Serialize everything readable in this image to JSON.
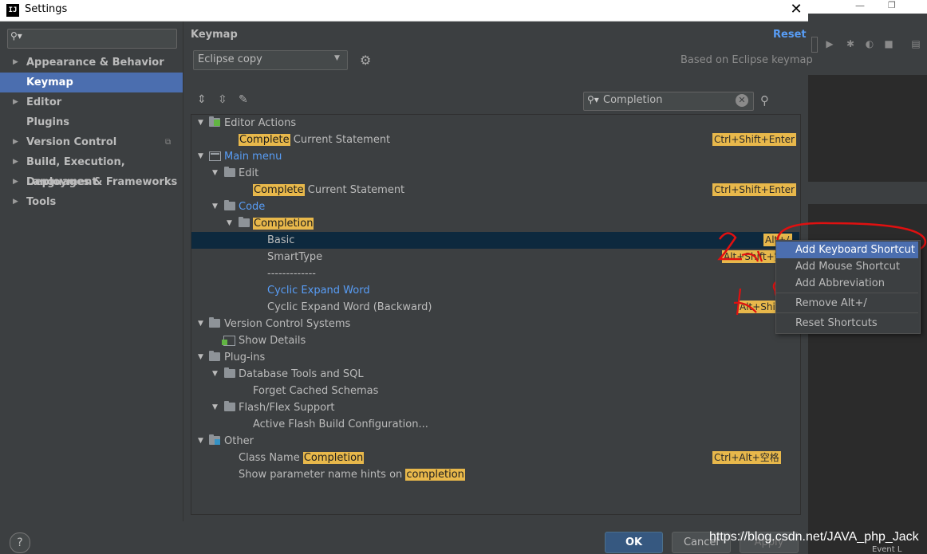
{
  "window": {
    "title": "Settings",
    "logo": "IJ",
    "close_icon": "✕"
  },
  "sidebar": {
    "search_placeholder": "",
    "items": [
      {
        "label": "Appearance & Behavior",
        "expandable": true
      },
      {
        "label": "Keymap",
        "selected": true
      },
      {
        "label": "Editor",
        "expandable": true
      },
      {
        "label": "Plugins"
      },
      {
        "label": "Version Control",
        "expandable": true
      },
      {
        "label": "Build, Execution, Deployment",
        "expandable": true
      },
      {
        "label": "Languages & Frameworks",
        "expandable": true
      },
      {
        "label": "Tools",
        "expandable": true
      }
    ]
  },
  "keymap": {
    "title": "Keymap",
    "reset": "Reset",
    "selected_keymap": "Eclipse copy",
    "based_on": "Based on Eclipse keymap",
    "filter_value": "Completion"
  },
  "tree": {
    "rows": [
      {
        "pre": "",
        "hl": "",
        "post": "Editor Actions",
        "shortcut": ""
      },
      {
        "pre": "",
        "hl": "Complete",
        "post": " Current Statement",
        "shortcut": "Ctrl+Shift+Enter"
      },
      {
        "pre": "",
        "hl": "",
        "post": "Main menu",
        "shortcut": ""
      },
      {
        "pre": "",
        "hl": "",
        "post": "Edit",
        "shortcut": ""
      },
      {
        "pre": "",
        "hl": "Complete",
        "post": " Current Statement",
        "shortcut": "Ctrl+Shift+Enter"
      },
      {
        "pre": "",
        "hl": "",
        "post": "Code",
        "shortcut": ""
      },
      {
        "pre": "",
        "hl": "Completion",
        "post": "",
        "shortcut": ""
      },
      {
        "pre": "",
        "hl": "",
        "post": "Basic",
        "shortcut": "Alt+/"
      },
      {
        "pre": "",
        "hl": "",
        "post": "SmartType",
        "shortcut": "Alt+Shift+空格"
      },
      {
        "pre": "",
        "hl": "",
        "post": "-------------",
        "shortcut": ""
      },
      {
        "pre": "",
        "hl": "",
        "post": "Cyclic Expand Word",
        "shortcut": ""
      },
      {
        "pre": "",
        "hl": "",
        "post": "Cyclic Expand Word (Backward)",
        "shortcut": "Alt+Shift+/"
      },
      {
        "pre": "",
        "hl": "",
        "post": "Version Control Systems",
        "shortcut": ""
      },
      {
        "pre": "",
        "hl": "",
        "post": "Show Details",
        "shortcut": ""
      },
      {
        "pre": "",
        "hl": "",
        "post": "Plug-ins",
        "shortcut": ""
      },
      {
        "pre": "",
        "hl": "",
        "post": "Database Tools and SQL",
        "shortcut": ""
      },
      {
        "pre": "",
        "hl": "",
        "post": "Forget Cached Schemas",
        "shortcut": ""
      },
      {
        "pre": "",
        "hl": "",
        "post": "Flash/Flex Support",
        "shortcut": ""
      },
      {
        "pre": "",
        "hl": "",
        "post": "Active Flash Build Configuration...",
        "shortcut": ""
      },
      {
        "pre": "",
        "hl": "",
        "post": "Other",
        "shortcut": ""
      },
      {
        "pre": "Class Name ",
        "hl": "Completion",
        "post": "",
        "shortcut": "Ctrl+Alt+空格"
      },
      {
        "pre": "Show parameter name hints on ",
        "hl": "completion",
        "post": "",
        "shortcut": ""
      }
    ]
  },
  "context_menu": {
    "items": [
      "Add Keyboard Shortcut",
      "Add Mouse Shortcut",
      "Add Abbreviation",
      "Remove Alt+/",
      "Reset Shortcuts"
    ]
  },
  "footer": {
    "help": "?",
    "ok": "OK",
    "cancel": "Cancel",
    "apply": "Apply"
  },
  "watermark": "https://blog.csdn.net/JAVA_php_Jack",
  "bg_window": {
    "status": "Event L"
  },
  "colors": {
    "accent": "#4b6eaf",
    "highlight": "#e8b84b",
    "link": "#589df6",
    "annotation": "#e01010"
  }
}
